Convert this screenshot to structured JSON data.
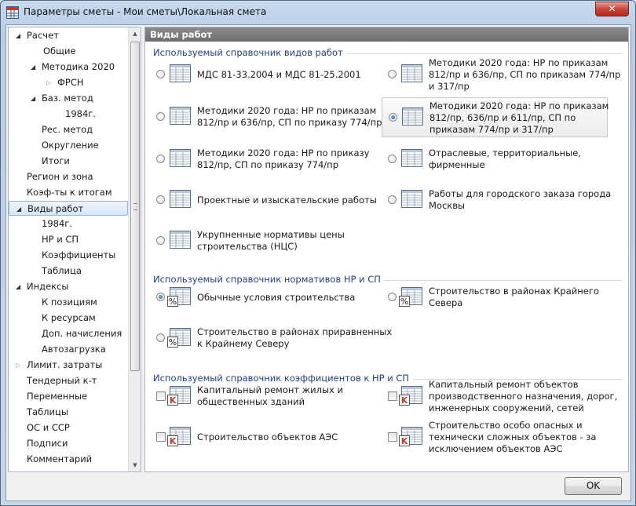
{
  "window": {
    "title": "Параметры сметы - Мои сметы\\Локальная смета",
    "close_glyph": "✕",
    "app_icon": "calculator-grid-icon"
  },
  "tree": {
    "items": [
      {
        "label": "Расчет",
        "level": 0,
        "arrow": "expanded"
      },
      {
        "label": "Общие",
        "level": 2,
        "arrow": "none"
      },
      {
        "label": "Методика 2020",
        "level": 1,
        "arrow": "expanded"
      },
      {
        "label": "ФРСН",
        "level": 2,
        "arrow": "collapsed"
      },
      {
        "label": "Баз. метод",
        "level": 1,
        "arrow": "expanded"
      },
      {
        "label": "1984г.",
        "level": 3,
        "arrow": "none"
      },
      {
        "label": "Рес. метод",
        "level": 1,
        "arrow": "none"
      },
      {
        "label": "Округление",
        "level": 1,
        "arrow": "none"
      },
      {
        "label": "Итоги",
        "level": 1,
        "arrow": "none"
      },
      {
        "label": "Регион и зона",
        "level": 0,
        "arrow": "none"
      },
      {
        "label": "Коэф-ты к итогам",
        "level": 0,
        "arrow": "none"
      },
      {
        "label": "Виды работ",
        "level": 0,
        "arrow": "expanded",
        "selected": true
      },
      {
        "label": "1984г.",
        "level": 1,
        "arrow": "none"
      },
      {
        "label": "НР и СП",
        "level": 1,
        "arrow": "none"
      },
      {
        "label": "Коэффициенты",
        "level": 1,
        "arrow": "none"
      },
      {
        "label": "Таблица",
        "level": 1,
        "arrow": "none"
      },
      {
        "label": "Индексы",
        "level": 0,
        "arrow": "expanded"
      },
      {
        "label": "К позициям",
        "level": 1,
        "arrow": "none"
      },
      {
        "label": "К ресурсам",
        "level": 1,
        "arrow": "none"
      },
      {
        "label": "Доп. начисления",
        "level": 1,
        "arrow": "none"
      },
      {
        "label": "Автозагрузка",
        "level": 1,
        "arrow": "none"
      },
      {
        "label": "Лимит. затраты",
        "level": 0,
        "arrow": "collapsed"
      },
      {
        "label": "Тендерный к-т",
        "level": 0,
        "arrow": "none"
      },
      {
        "label": "Переменные",
        "level": 0,
        "arrow": "none"
      },
      {
        "label": "Таблицы",
        "level": 0,
        "arrow": "none"
      },
      {
        "label": "ОС и ССР",
        "level": 0,
        "arrow": "none"
      },
      {
        "label": "Подписи",
        "level": 0,
        "arrow": "none"
      },
      {
        "label": "Комментарий",
        "level": 0,
        "arrow": "none"
      }
    ]
  },
  "panel": {
    "header": "Виды работ",
    "groups": [
      {
        "title": "Используемый справочник видов работ",
        "control": "radio",
        "icon": "table-icon",
        "options": [
          {
            "text": "МДС 81-33.2004 и МДС 81-25.2001",
            "checked": false,
            "col": 0
          },
          {
            "text": "Методики 2020 года: НР по приказам\n812/пр и 636/пр, СП по приказам 774/пр\nи 317/пр",
            "checked": false,
            "col": 1
          },
          {
            "text": "Методики 2020 года: НР по приказам\n812/пр и 636/пр, СП по приказу 774/пр",
            "checked": false,
            "col": 0
          },
          {
            "text": "Методики 2020 года: НР по приказам\n812/пр, 636/пр и 611/пр, СП по\nприказам 774/пр и 317/пр",
            "checked": true,
            "col": 1
          },
          {
            "text": "Методики 2020 года: НР по приказу\n812/пр, СП по приказу 774/пр",
            "checked": false,
            "col": 0
          },
          {
            "text": "Отраслевые, территориальные,\nфирменные",
            "checked": false,
            "col": 1
          },
          {
            "text": "Проектные и изыскательские работы",
            "checked": false,
            "col": 0
          },
          {
            "text": "Работы для городского заказа города\nМосквы",
            "checked": false,
            "col": 1
          },
          {
            "text": "Укрупненные нормативы цены\nстроительства (НЦС)",
            "checked": false,
            "col": 0
          }
        ]
      },
      {
        "title": "Используемый справочник нормативов НР и СП",
        "control": "radio",
        "icon": "percent-table-icon",
        "options": [
          {
            "text": "Обычные условия строительства",
            "checked": true,
            "col": 0
          },
          {
            "text": "Строительство в районах Крайнего\nСевера",
            "checked": false,
            "col": 1
          },
          {
            "text": "Строительство в районах приравненных\nк Крайнему Северу",
            "checked": false,
            "col": 0
          }
        ]
      },
      {
        "title": "Используемый справочник коэффициентов к НР и СП",
        "control": "checkbox",
        "icon": "k-table-icon",
        "options": [
          {
            "text": "Капитальный ремонт жилых и\nобщественных зданий",
            "checked": false,
            "col": 0
          },
          {
            "text": "Капитальный ремонт объектов\nпроизводственного назначения, дорог,\nинженерных сооружений, сетей",
            "checked": false,
            "col": 1
          },
          {
            "text": "Строительство объектов АЭС",
            "checked": false,
            "col": 0
          },
          {
            "text": "Строительство особо опасных и\nтехнически сложных объектов - за\nисключением объектов АЭС",
            "checked": false,
            "col": 1
          }
        ]
      }
    ]
  },
  "footer": {
    "ok_label": "OK"
  },
  "colors": {
    "group_title": "#1e3f8f",
    "selection": "#d4e6fa",
    "header": "#6e6e6e",
    "k_mark": "#c0392b"
  }
}
